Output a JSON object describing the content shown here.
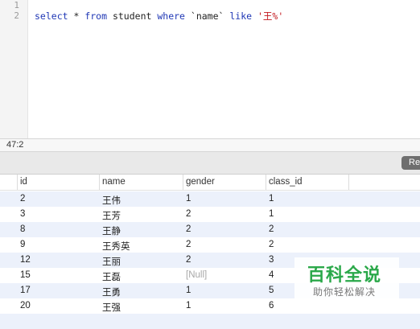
{
  "editor": {
    "line_numbers": [
      "1",
      "2"
    ],
    "query": {
      "p1": "select",
      "p2": " * ",
      "p3": "from",
      "p4": " student ",
      "p5": "where",
      "p6": " `name` ",
      "p7": "like",
      "p8": " ",
      "p9": "'王%'"
    }
  },
  "status": {
    "cursor_position": "47:2"
  },
  "toolbar": {
    "button_label": "Re"
  },
  "table": {
    "columns": [
      "id",
      "name",
      "gender",
      "class_id"
    ],
    "rows": [
      [
        "2",
        "王伟",
        "1",
        "1"
      ],
      [
        "3",
        "王芳",
        "2",
        "1"
      ],
      [
        "8",
        "王静",
        "2",
        "2"
      ],
      [
        "9",
        "王秀英",
        "2",
        "2"
      ],
      [
        "12",
        "王丽",
        "2",
        "3"
      ],
      [
        "15",
        "王磊",
        "[Null]",
        "4"
      ],
      [
        "17",
        "王勇",
        "1",
        "5"
      ],
      [
        "20",
        "王强",
        "1",
        "6"
      ]
    ]
  },
  "watermark": {
    "title": "百科全说",
    "subtitle": "助你轻松解决"
  },
  "colors": {
    "keyword": "#1f37b5",
    "string": "#c2161d",
    "row_alt": "#ecf1fb",
    "watermark": "#2aa84a"
  }
}
